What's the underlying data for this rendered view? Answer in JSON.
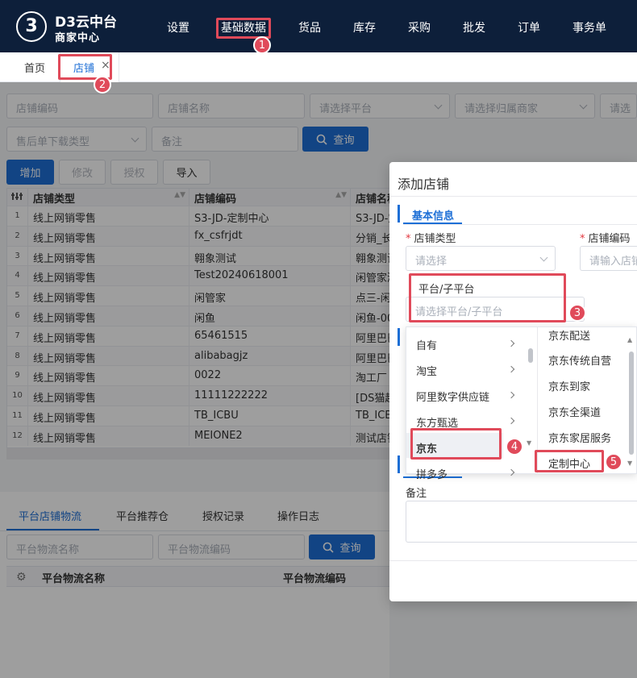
{
  "app": {
    "logo_mark": "3",
    "title": "D3云中台",
    "subtitle": "商家中心"
  },
  "nav": [
    "设置",
    "基础数据",
    "货品",
    "库存",
    "采购",
    "批发",
    "订单",
    "事务单"
  ],
  "tabs": {
    "home": "首页",
    "store": "店铺",
    "close": "×"
  },
  "filters": {
    "store_code": "店铺编码",
    "store_name": "店铺名称",
    "platform": "请选择平台",
    "merchant": "请选择归属商家",
    "more": "请选",
    "aftersale": "售后单下载类型",
    "remark": "备注",
    "query": "查询"
  },
  "toolbar": {
    "add": "增加",
    "edit": "修改",
    "auth": "授权",
    "import": "导入"
  },
  "table": {
    "headers": [
      "店铺类型",
      "店铺编码",
      "店铺名称"
    ],
    "rows": [
      {
        "n": "1",
        "type": "线上网销零售",
        "code": "S3-JD-定制中心",
        "name": "S3-JD-定"
      },
      {
        "n": "2",
        "type": "线上网销零售",
        "code": "fx_csfrjdt",
        "name": "分销_长"
      },
      {
        "n": "3",
        "type": "线上网销零售",
        "code": "翱象测试",
        "name": "翱象测试"
      },
      {
        "n": "4",
        "type": "线上网销零售",
        "code": "Test20240618001",
        "name": "闲管家测"
      },
      {
        "n": "5",
        "type": "线上网销零售",
        "code": "闲管家",
        "name": "点三-闲"
      },
      {
        "n": "6",
        "type": "线上网销零售",
        "code": "闲鱼",
        "name": "闲鱼-00"
      },
      {
        "n": "7",
        "type": "线上网销零售",
        "code": "65461515",
        "name": "阿里巴巴"
      },
      {
        "n": "8",
        "type": "线上网销零售",
        "code": "alibabagjz",
        "name": "阿里巴巴"
      },
      {
        "n": "9",
        "type": "线上网销零售",
        "code": "0022",
        "name": "淘工厂"
      },
      {
        "n": "10",
        "type": "线上网销零售",
        "code": "11111222222",
        "name": "[DS猫超"
      },
      {
        "n": "11",
        "type": "线上网销零售",
        "code": "TB_ICBU",
        "name": "TB_ICBU"
      },
      {
        "n": "12",
        "type": "线上网销零售",
        "code": "MEIONE2",
        "name": "测试店铺"
      }
    ]
  },
  "bottom": {
    "tabs": [
      "平台店铺物流",
      "平台推荐仓",
      "授权记录",
      "操作日志"
    ],
    "logistics_name": "平台物流名称",
    "logistics_code": "平台物流编码",
    "query": "查询",
    "col1": "平台物流名称",
    "col2": "平台物流编码"
  },
  "dialog": {
    "title": "添加店铺",
    "section": "基本信息",
    "store_type_label": "店铺类型",
    "store_type_placeholder": "请选择",
    "store_code_label": "店铺编码",
    "store_code_placeholder": "请输入店铺",
    "platform_label": "平台/子平台",
    "platform_placeholder": "请选择平台/子平台",
    "remark_label": "备注",
    "required_mark": "*"
  },
  "cascader": {
    "platforms": [
      "自有",
      "淘宝",
      "阿里数字供应链",
      "东方甄选",
      "京东",
      "拼多多"
    ],
    "sub_platforms": [
      "京东配送",
      "京东传统自营",
      "京东到家",
      "京东全渠道",
      "京东家居服务",
      "定制中心"
    ]
  },
  "annotations": [
    "1",
    "2",
    "3",
    "4",
    "5"
  ],
  "colors": {
    "primary": "#1d6fd6",
    "topbar": "#0d1f3a",
    "highlight": "#e04a5a"
  }
}
